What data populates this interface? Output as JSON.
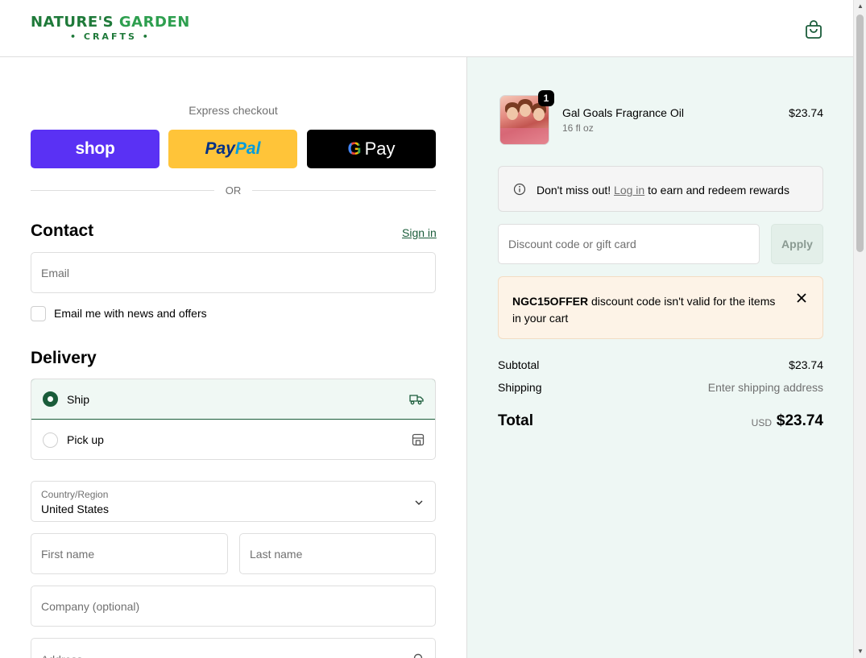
{
  "brand": {
    "line1_a": "NATURE'S",
    "line1_b": "GARDEN",
    "line2": "• CRAFTS •"
  },
  "express": {
    "label": "Express checkout",
    "shop_label": "shop",
    "paypal_a": "Pay",
    "paypal_b": "Pal",
    "gpay_g": "G",
    "gpay_label": "Pay",
    "or": "OR"
  },
  "contact": {
    "title": "Contact",
    "sign_in": "Sign in",
    "email_placeholder": "Email",
    "newsletter_label": "Email me with news and offers",
    "newsletter_checked": false
  },
  "delivery": {
    "title": "Delivery",
    "options": [
      {
        "label": "Ship",
        "selected": true,
        "icon": "truck-icon"
      },
      {
        "label": "Pick up",
        "selected": false,
        "icon": "store-icon"
      }
    ]
  },
  "address": {
    "country_label": "Country/Region",
    "country_value": "United States",
    "first_name_placeholder": "First name",
    "last_name_placeholder": "Last name",
    "company_placeholder": "Company (optional)",
    "address_placeholder": "Address"
  },
  "order": {
    "item": {
      "name": "Gal Goals Fragrance Oil",
      "variant": "16 fl oz",
      "price": "$23.74",
      "quantity": "1"
    },
    "rewards": {
      "prefix": "Don't miss out!",
      "link": "Log in",
      "suffix": "to earn and redeem rewards"
    },
    "discount_placeholder": "Discount code or gift card",
    "apply_label": "Apply",
    "error": {
      "code": "NGC15OFFER",
      "message": "discount code isn't valid for the items in your cart"
    },
    "subtotal_label": "Subtotal",
    "subtotal_value": "$23.74",
    "shipping_label": "Shipping",
    "shipping_value": "Enter shipping address",
    "total_label": "Total",
    "total_currency": "USD",
    "total_value": "$23.74"
  },
  "colors": {
    "accent": "#1a5c3a",
    "brand": "#1f7a3a",
    "shop": "#5a31f4",
    "paypal": "#ffc439",
    "summary_bg": "#eef7f4",
    "error_bg": "#fdf3e7"
  }
}
